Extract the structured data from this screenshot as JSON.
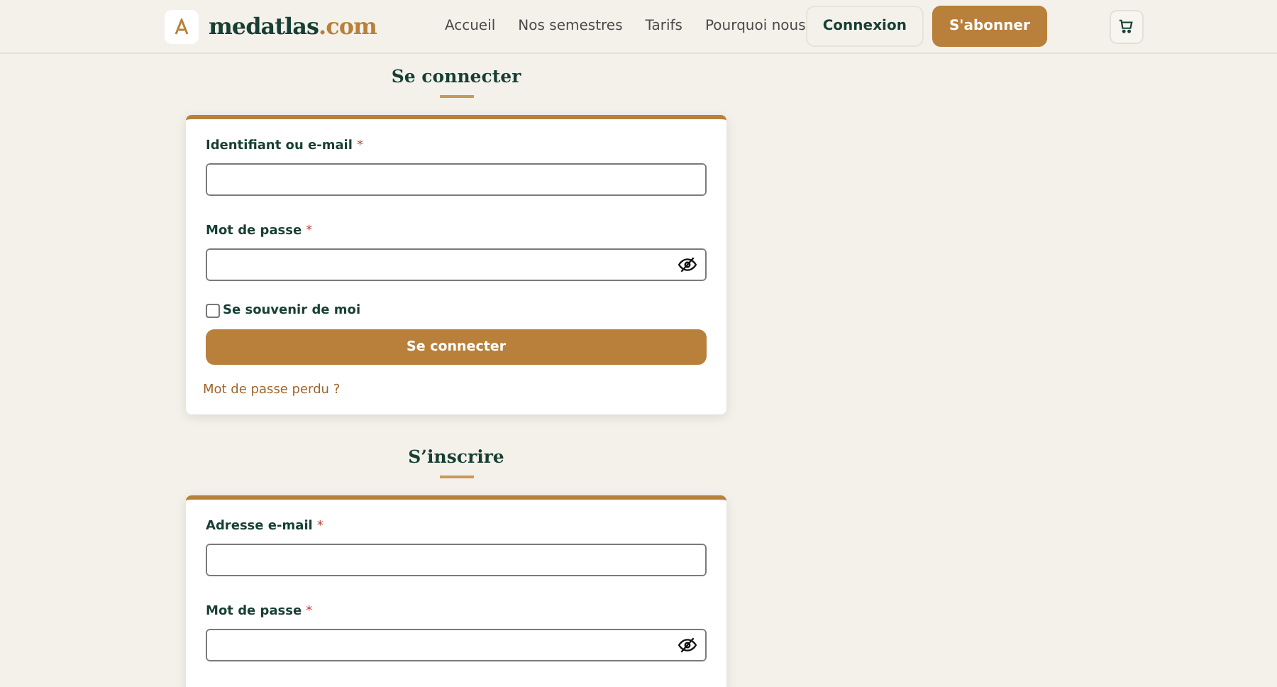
{
  "header": {
    "logo": {
      "name": "medatlas",
      "suffix": ".com"
    },
    "nav": [
      {
        "label": "Accueil"
      },
      {
        "label": "Nos semestres"
      },
      {
        "label": "Tarifs"
      },
      {
        "label": "Pourquoi nous"
      }
    ],
    "login_button": "Connexion",
    "subscribe_button": "S'abonner"
  },
  "sections": [
    {
      "title": "Se connecter",
      "fields": [
        {
          "label": "Identifiant ou e-mail",
          "marker": "*",
          "kind": "text"
        },
        {
          "label": "Mot de passe",
          "marker": "*",
          "kind": "password"
        }
      ],
      "remember": {
        "label": "Se souvenir de moi",
        "checked": false
      },
      "submit": "Se connecter",
      "link": "Mot de passe perdu ?"
    },
    {
      "title": "S’inscrire",
      "fields": [
        {
          "label": "Adresse e-mail",
          "marker": "*",
          "kind": "text"
        },
        {
          "label": "Mot de passe",
          "marker": "*",
          "kind": "password"
        }
      ]
    }
  ]
}
